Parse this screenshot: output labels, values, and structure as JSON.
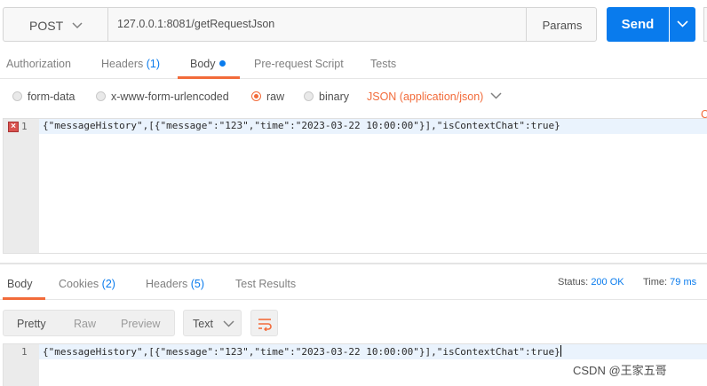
{
  "request": {
    "method": "POST",
    "url": "127.0.0.1:8081/getRequestJson",
    "params_label": "Params",
    "send_label": "Send"
  },
  "request_tabs": {
    "authorization": "Authorization",
    "headers": "Headers",
    "headers_count": "(1)",
    "body": "Body",
    "prerequest": "Pre-request Script",
    "tests": "Tests",
    "overflow": "C"
  },
  "body_options": {
    "form_data": "form-data",
    "urlencoded": "x-www-form-urlencoded",
    "raw": "raw",
    "binary": "binary",
    "selected": "raw",
    "content_type": "JSON (application/json)"
  },
  "request_editor": {
    "line_number": "1",
    "code": "{\"messageHistory\",[{\"message\":\"123\",\"time\":\"2023-03-22 10:00:00\"}],\"isContextChat\":true}",
    "error_marker": "×"
  },
  "response_tabs": {
    "body": "Body",
    "cookies": "Cookies",
    "cookies_count": "(2)",
    "headers": "Headers",
    "headers_count": "(5)",
    "test_results": "Test Results",
    "status_label": "Status:",
    "status_value": "200 OK",
    "time_label": "Time:",
    "time_value": "79 ms"
  },
  "response_view": {
    "pretty": "Pretty",
    "raw": "Raw",
    "preview": "Preview",
    "format": "Text",
    "selected": "Pretty"
  },
  "response_editor": {
    "line_number": "1",
    "code": "{\"messageHistory\",[{\"message\":\"123\",\"time\":\"2023-03-22 10:00:00\"}],\"isContextChat\":true}"
  },
  "watermark": "CSDN @王家五哥",
  "colors": {
    "accent": "#097bed",
    "highlight": "#f26b3a",
    "line_highlight": "#eaf3fd"
  }
}
